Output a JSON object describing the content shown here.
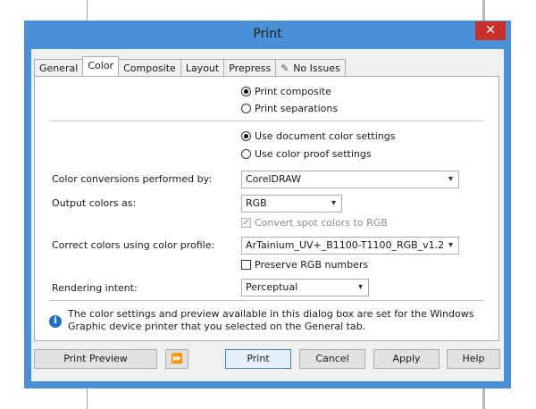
{
  "window": {
    "title": "Print",
    "close_icon": "close-icon"
  },
  "tabs": [
    {
      "label": "General",
      "active": false
    },
    {
      "label": "Color",
      "active": true
    },
    {
      "label": "Composite",
      "active": false
    },
    {
      "label": "Layout",
      "active": false
    },
    {
      "label": "Prepress",
      "active": false
    },
    {
      "label": "No Issues",
      "active": false,
      "icon": "check-icon"
    }
  ],
  "color_tab": {
    "print_mode": {
      "composite": "Print composite",
      "separations": "Print separations",
      "selected": "composite"
    },
    "settings_source": {
      "document": "Use document color settings",
      "proof": "Use color proof settings",
      "selected": "document"
    },
    "conversions": {
      "label": "Color conversions performed by:",
      "value": "CorelDRAW"
    },
    "output": {
      "label": "Output colors as:",
      "value": "RGB"
    },
    "convert_spot": {
      "label": "Convert spot colors to RGB",
      "checked": true,
      "enabled": false
    },
    "profile": {
      "label": "Correct colors using color profile:",
      "value": "ArTainium_UV+_B1100-T1100_RGB_v1.2"
    },
    "preserve_rgb": {
      "label": "Preserve RGB numbers",
      "checked": false
    },
    "rendering": {
      "label": "Rendering intent:",
      "value": "Perceptual"
    },
    "info": {
      "icon": "info-icon",
      "text": "The color settings and preview available in this dialog box are set for the Windows Graphic device printer that you selected on the General tab."
    }
  },
  "buttons": {
    "print_preview": "Print Preview",
    "expand_preview_icon": "double-arrow-right-icon",
    "print": "Print",
    "cancel": "Cancel",
    "apply": "Apply",
    "help": "Help"
  },
  "colors": {
    "window_frame": "#4a90d6",
    "close_button": "#c7312a",
    "info_icon": "#1e6fc8"
  }
}
